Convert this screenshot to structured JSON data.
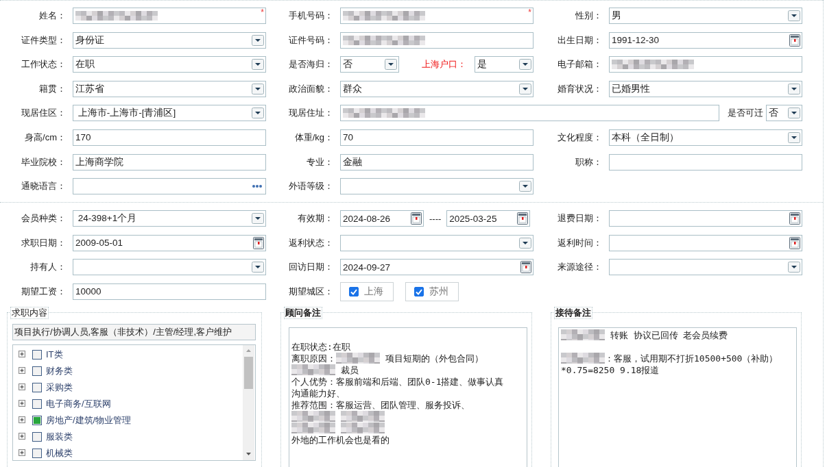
{
  "sections": [
    {
      "rows": [
        [
          {
            "label": "姓名：",
            "controls": [
              {
                "kind": "text",
                "redacted": true,
                "required_mark": "*"
              }
            ]
          },
          {
            "label": "手机号码：",
            "controls": [
              {
                "kind": "text",
                "redacted": true,
                "required_mark": "*"
              }
            ]
          },
          {
            "label": "性别：",
            "controls": [
              {
                "kind": "select",
                "value": "男"
              }
            ]
          }
        ],
        [
          {
            "label": "证件类型：",
            "controls": [
              {
                "kind": "select",
                "value": "身份证"
              }
            ]
          },
          {
            "label": "证件号码：",
            "controls": [
              {
                "kind": "text",
                "redacted": true
              }
            ]
          },
          {
            "label": "出生日期：",
            "controls": [
              {
                "kind": "date",
                "value": "1991-12-30"
              }
            ]
          }
        ],
        [
          {
            "label": "工作状态：",
            "controls": [
              {
                "kind": "select",
                "value": "在职"
              }
            ]
          },
          {
            "label": "是否海归：",
            "controls": [
              {
                "kind": "select-small",
                "value": "否"
              },
              {
                "kind": "label",
                "text": "上海户口：",
                "highlighted": true
              },
              {
                "kind": "select-small",
                "value": "是"
              }
            ]
          },
          {
            "label": "电子邮箱：",
            "controls": [
              {
                "kind": "text",
                "redacted": true
              }
            ]
          }
        ],
        [
          {
            "label": "籍贯：",
            "controls": [
              {
                "kind": "select",
                "value": "江苏省"
              }
            ]
          },
          {
            "label": "政治面貌：",
            "controls": [
              {
                "kind": "select",
                "value": "群众"
              }
            ]
          },
          {
            "label": "婚育状况：",
            "controls": [
              {
                "kind": "select",
                "value": "已婚男性"
              }
            ]
          }
        ],
        [
          {
            "label": "现居住区：",
            "controls": [
              {
                "kind": "select",
                "value": " 上海市-上海市-[青浦区]"
              }
            ]
          },
          {
            "label": "现居住址：",
            "wide": true,
            "controls": [
              {
                "kind": "text",
                "redacted": true
              },
              {
                "kind": "label",
                "text": "是否可迁",
                "highlighted": false
              },
              {
                "kind": "select-tiny",
                "value": "否"
              }
            ]
          }
        ],
        [
          {
            "label": "身高/cm：",
            "controls": [
              {
                "kind": "text",
                "value": "170"
              }
            ]
          },
          {
            "label": "体重/kg：",
            "controls": [
              {
                "kind": "text",
                "value": "70"
              }
            ]
          },
          {
            "label": "文化程度：",
            "controls": [
              {
                "kind": "select",
                "value": "本科（全日制）"
              }
            ]
          }
        ],
        [
          {
            "label": "毕业院校：",
            "controls": [
              {
                "kind": "text",
                "value": "上海商学院"
              }
            ]
          },
          {
            "label": "专业：",
            "controls": [
              {
                "kind": "text",
                "value": "金融"
              }
            ]
          },
          {
            "label": "职称：",
            "controls": [
              {
                "kind": "text"
              }
            ]
          }
        ],
        [
          {
            "label": "通晓语言：",
            "controls": [
              {
                "kind": "picker"
              }
            ]
          },
          {
            "label": "外语等级：",
            "controls": [
              {
                "kind": "select"
              }
            ]
          }
        ]
      ]
    },
    {
      "rows": [
        [
          {
            "label": "会员种类：",
            "controls": [
              {
                "kind": "select",
                "value": " 24-398+1个月"
              }
            ]
          },
          {
            "label": "有效期：",
            "controls": [
              {
                "kind": "date-small",
                "value": "2024-08-26"
              },
              {
                "kind": "separator",
                "text": "----"
              },
              {
                "kind": "date-small",
                "value": "2025-03-25"
              }
            ]
          },
          {
            "label": "退费日期：",
            "controls": [
              {
                "kind": "date"
              }
            ]
          }
        ],
        [
          {
            "label": "求职日期：",
            "controls": [
              {
                "kind": "date",
                "value": "2009-05-01"
              }
            ]
          },
          {
            "label": "返利状态：",
            "controls": [
              {
                "kind": "select"
              }
            ]
          },
          {
            "label": "返利时间：",
            "controls": [
              {
                "kind": "date"
              }
            ]
          }
        ],
        [
          {
            "label": "持有人：",
            "controls": [
              {
                "kind": "select"
              }
            ]
          },
          {
            "label": "回访日期：",
            "controls": [
              {
                "kind": "date",
                "value": "2024-09-27"
              }
            ]
          },
          {
            "label": "来源途径：",
            "controls": [
              {
                "kind": "select"
              }
            ]
          }
        ],
        [
          {
            "label": "期望工资：",
            "controls": [
              {
                "kind": "text",
                "value": "10000"
              }
            ]
          },
          {
            "label": "期望城区：",
            "controls": [
              {
                "kind": "check",
                "text": "上海",
                "checked": true
              },
              {
                "kind": "check",
                "text": "苏州",
                "checked": true
              }
            ]
          }
        ]
      ]
    }
  ],
  "panels": [
    {
      "kind": "tree",
      "title": "求职内容",
      "summary": "项目执行/协调人员,客服（非技术）/主管/经理,客户维护",
      "items": [
        {
          "label": "IT类",
          "checked": false,
          "expanded": false
        },
        {
          "label": "财务类",
          "checked": false,
          "expanded": false
        },
        {
          "label": "采购类",
          "checked": false,
          "expanded": false
        },
        {
          "label": "电子商务/互联网",
          "checked": false,
          "expanded": false
        },
        {
          "label": "房地产/建筑/物业管理",
          "checked": true,
          "expanded": false
        },
        {
          "label": "服装类",
          "checked": false,
          "expanded": false
        },
        {
          "label": "机械类",
          "checked": false,
          "expanded": false
        }
      ]
    },
    {
      "kind": "notes",
      "title": "顾问备注",
      "lines": [
        {
          "kind": "blank"
        },
        {
          "kind": "text",
          "parts": [
            {
              "text": "在职状态:在职"
            }
          ]
        },
        {
          "kind": "text",
          "parts": [
            {
              "text": "离职原因："
            },
            {
              "redacted": true
            },
            {
              "text": " 项目短期的（外包合同）"
            }
          ]
        },
        {
          "kind": "text",
          "parts": [
            {
              "redacted": true
            },
            {
              "text": " 裁员"
            }
          ]
        },
        {
          "kind": "text",
          "parts": [
            {
              "text": "个人优势：客服前端和后端、团队0-1搭建、做事认真"
            }
          ]
        },
        {
          "kind": "text",
          "parts": [
            {
              "text": "沟通能力好、"
            }
          ]
        },
        {
          "kind": "text",
          "parts": [
            {
              "text": "推荐范围：客服运营、团队管理、服务投诉、"
            }
          ]
        },
        {
          "kind": "text",
          "parts": [
            {
              "redacted": true
            },
            {
              "redacted": true
            }
          ]
        },
        {
          "kind": "text",
          "parts": [
            {
              "redacted": true
            },
            {
              "redacted": true
            }
          ]
        },
        {
          "kind": "text",
          "parts": [
            {
              "text": "外地的工作机会也是看的"
            }
          ]
        }
      ]
    },
    {
      "kind": "notes",
      "title": "接待备注",
      "lines": [
        {
          "kind": "text",
          "parts": [
            {
              "redacted": true
            },
            {
              "text": " 转账 协议已回传 老会员续费"
            }
          ]
        },
        {
          "kind": "blank"
        },
        {
          "kind": "text",
          "parts": [
            {
              "redacted": true
            },
            {
              "text": "：客服，试用期不打折10500+500（补助）"
            }
          ]
        },
        {
          "kind": "text",
          "parts": [
            {
              "text": "*0.75=8250 9.18报道"
            }
          ]
        }
      ]
    }
  ]
}
